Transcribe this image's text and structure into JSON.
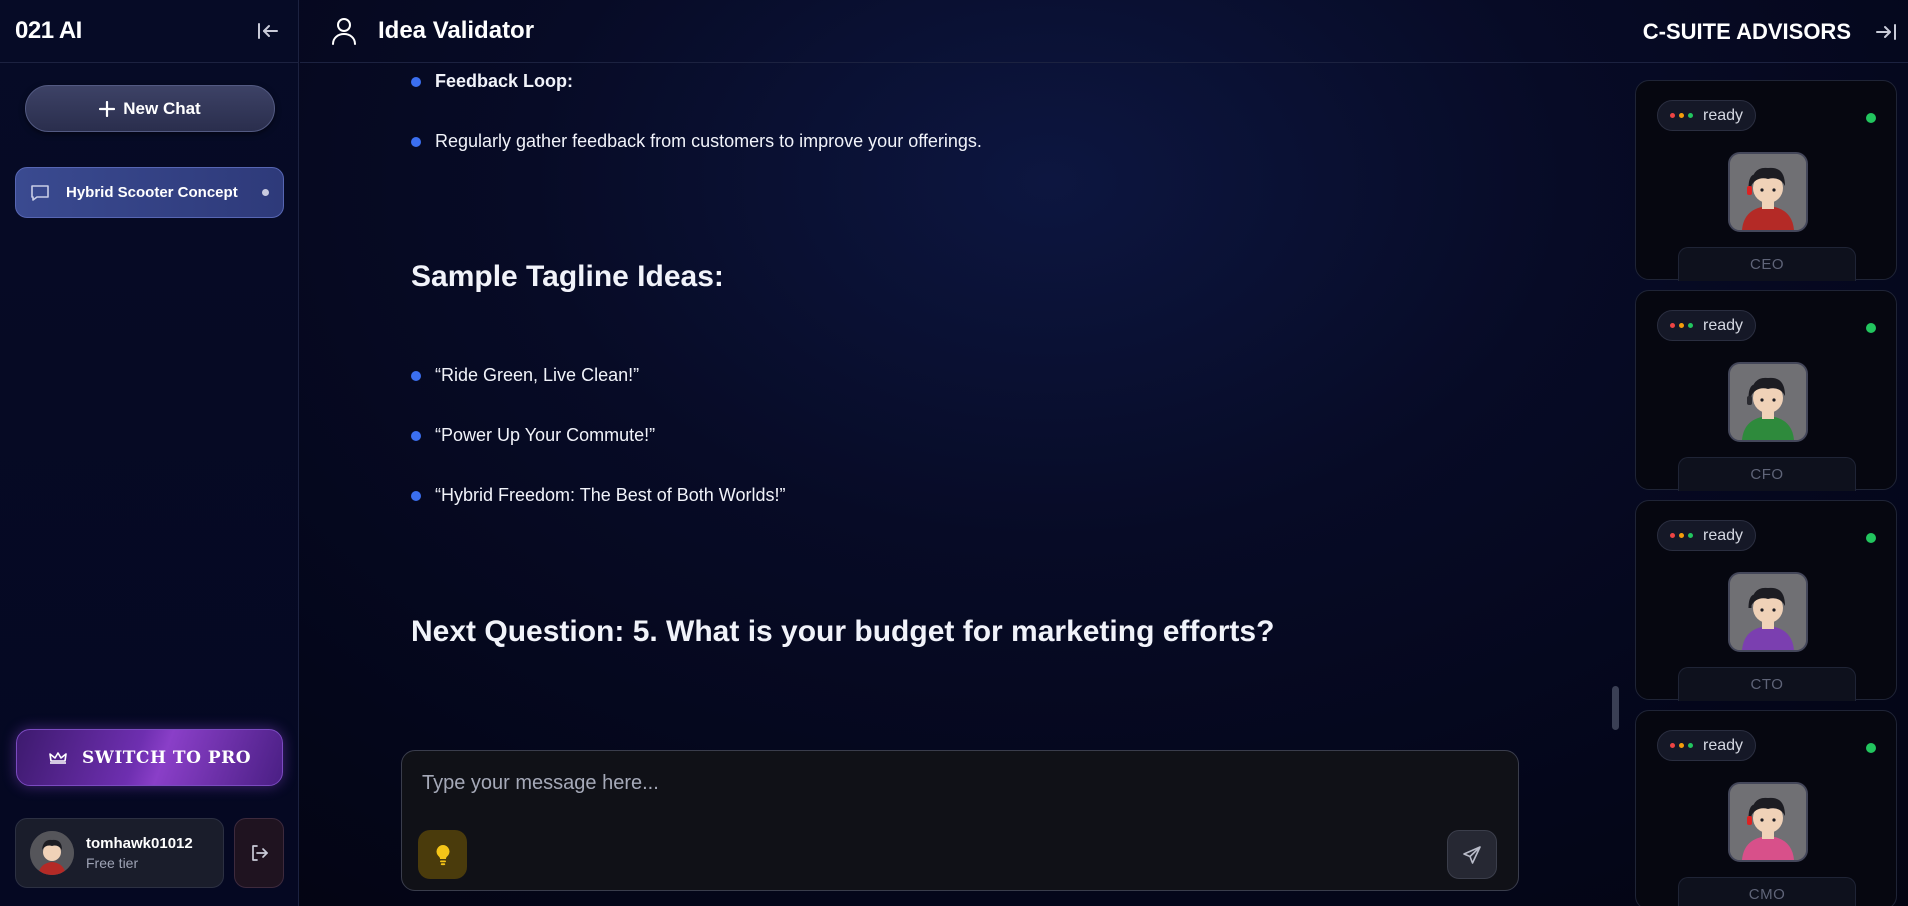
{
  "sidebar": {
    "brand": "021 AI",
    "new_chat_label": "New Chat",
    "chats": [
      {
        "label": "Hybrid Scooter Concept"
      }
    ],
    "pro_label": "SWITCH TO PRO",
    "user": {
      "name": "tomhawk01012",
      "tier": "Free tier"
    }
  },
  "header": {
    "title": "Idea Validator",
    "advisors_title": "C-SUITE ADVISORS"
  },
  "messages": {
    "feedback_title": "Feedback Loop:",
    "feedback_text": "Regularly gather feedback from customers to improve your offerings.",
    "taglines_heading": "Sample Tagline Ideas:",
    "taglines": [
      "“Ride Green, Live Clean!”",
      "“Power Up Your Commute!”",
      "“Hybrid Freedom: The Best of Both Worlds!”"
    ],
    "next_question": "Next Question: 5. What is your budget for marketing efforts?"
  },
  "composer": {
    "placeholder": "Type your message here..."
  },
  "advisors": [
    {
      "role": "CEO",
      "status": "ready",
      "hoodie": "#b42a26"
    },
    {
      "role": "CFO",
      "status": "ready",
      "hoodie": "#2e8a3c"
    },
    {
      "role": "CTO",
      "status": "ready",
      "hoodie": "#7b3fb0"
    },
    {
      "role": "CMO",
      "status": "ready",
      "hoodie": "#d8508a"
    }
  ],
  "colors": {
    "accent_blue": "#3b6ff0",
    "online_green": "#22c55e",
    "status_dots": [
      "#ef4444",
      "#f59e0b",
      "#22c55e"
    ]
  }
}
